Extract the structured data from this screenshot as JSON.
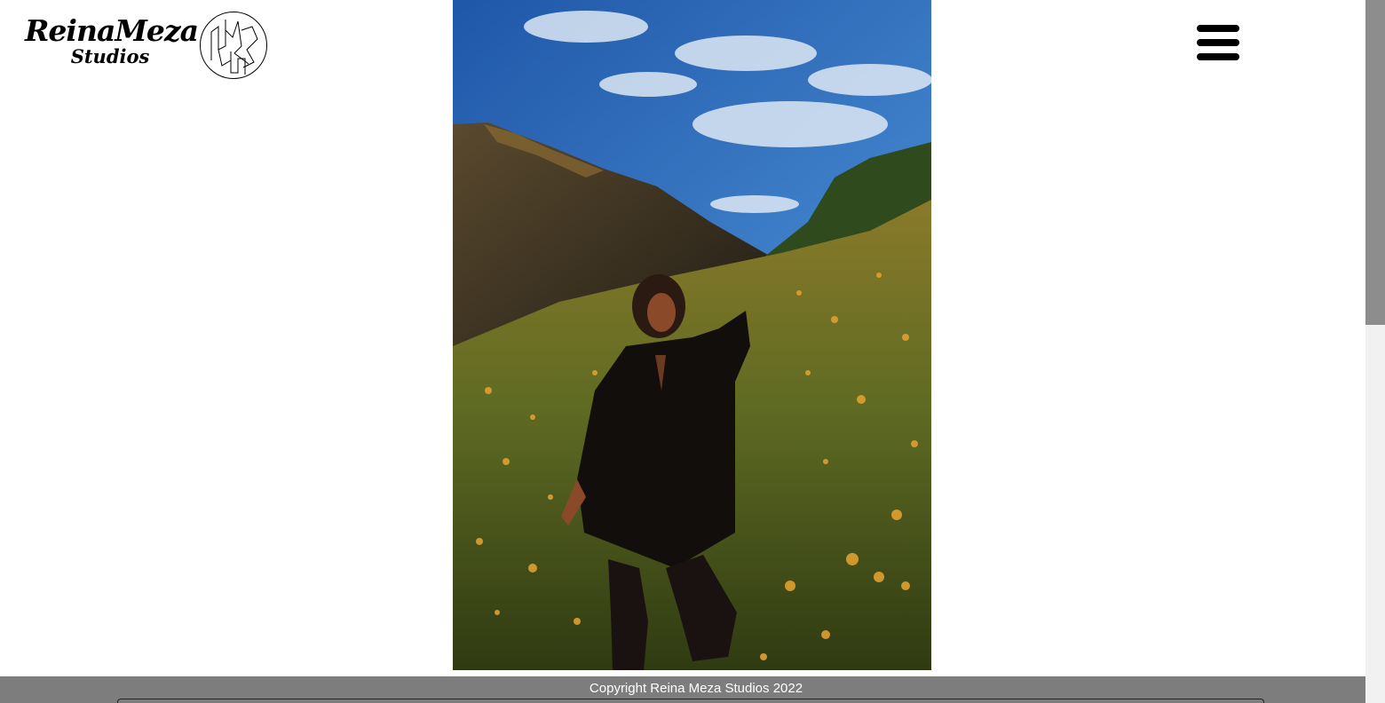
{
  "header": {
    "logo": {
      "title": "ReinaMeza",
      "subtitle": "Studios",
      "mark_icon": "geometric-monogram-icon"
    },
    "menu_icon": "hamburger-icon"
  },
  "main": {
    "photo": {
      "description_icon": "portrait-photo"
    }
  },
  "footer": {
    "copyright": "Copyright Reina Meza Studios 2022"
  },
  "colors": {
    "footer_bg": "#7d7d7d",
    "footer_text": "#ffffff",
    "page_bg": "#ffffff",
    "scroll_thumb": "#8d8d8d"
  }
}
